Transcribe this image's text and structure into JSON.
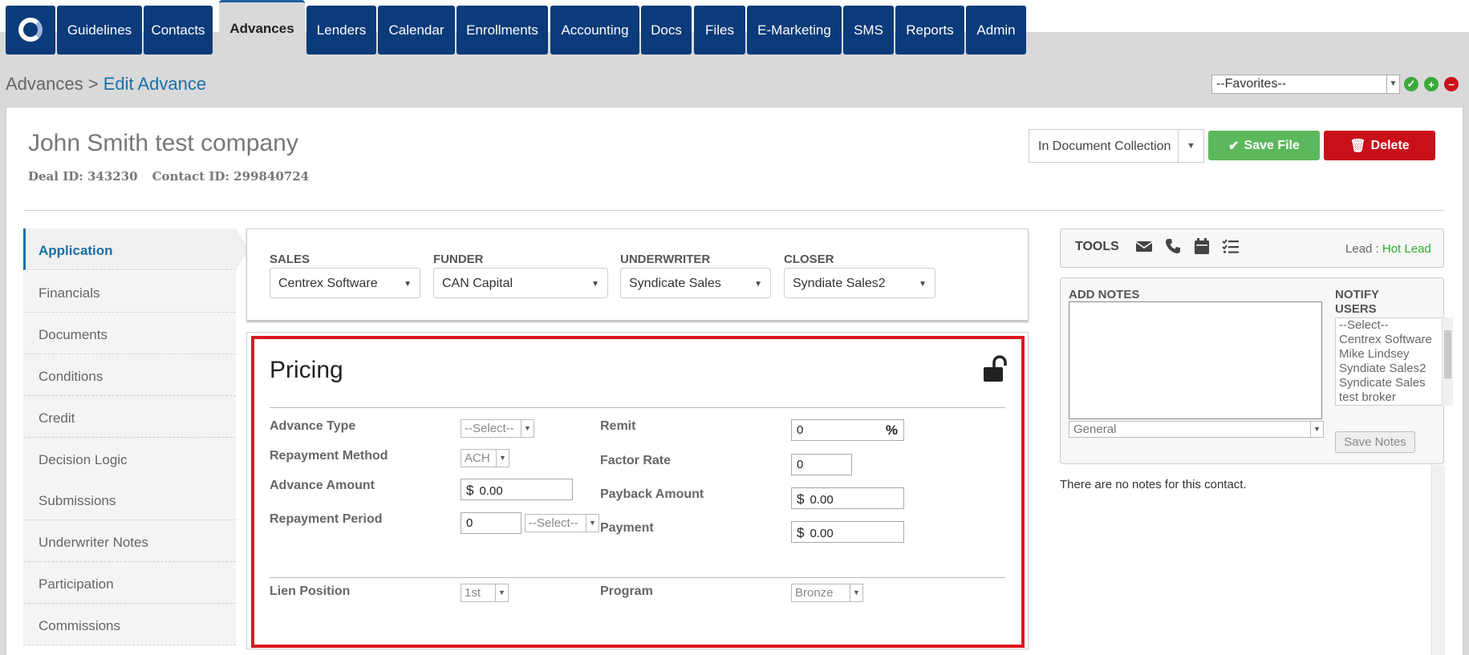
{
  "nav": {
    "tabs": [
      "Guidelines",
      "Contacts",
      "Advances",
      "Lenders",
      "Calendar",
      "Enrollments",
      "Accounting",
      "Docs",
      "Files",
      "E-Marketing",
      "SMS",
      "Reports",
      "Admin"
    ],
    "active": "Advances"
  },
  "breadcrumb": {
    "parent": "Advances",
    "separator": " > ",
    "current": "Edit Advance"
  },
  "favorites": {
    "value": "--Favorites--"
  },
  "record": {
    "company": "John Smith test company",
    "deal_id": "Deal ID: 343230",
    "contact_id": "Contact ID: 299840724",
    "status": "In Document Collection",
    "save_label": "Save File",
    "delete_label": "Delete"
  },
  "sidebar": {
    "items": [
      "Application",
      "Financials",
      "Documents",
      "Conditions",
      "Credit",
      "Decision Logic",
      "Submissions",
      "Underwriter Notes",
      "Participation",
      "Commissions"
    ],
    "active": "Application"
  },
  "team": {
    "sales": {
      "label": "SALES",
      "value": "Centrex Software"
    },
    "funder": {
      "label": "FUNDER",
      "value": "CAN Capital"
    },
    "underwriter": {
      "label": "UNDERWRITER",
      "value": "Syndicate Sales"
    },
    "closer": {
      "label": "CLOSER",
      "value": "Syndiate Sales2"
    }
  },
  "pricing": {
    "title": "Pricing",
    "advance_type": {
      "label": "Advance Type",
      "value": "--Select--"
    },
    "repayment_method": {
      "label": "Repayment Method",
      "value": "ACH"
    },
    "advance_amount": {
      "label": "Advance Amount",
      "currency": "$",
      "value": "0.00"
    },
    "repayment_period": {
      "label": "Repayment Period",
      "value": "0",
      "unit": "--Select--"
    },
    "remit": {
      "label": "Remit",
      "value": "0",
      "suffix": "%"
    },
    "factor_rate": {
      "label": "Factor Rate",
      "value": "0"
    },
    "payback_amount": {
      "label": "Payback Amount",
      "currency": "$",
      "value": "0.00"
    },
    "payment": {
      "label": "Payment",
      "currency": "$",
      "value": "0.00"
    },
    "lien_position": {
      "label": "Lien Position",
      "value": "1st"
    },
    "program": {
      "label": "Program",
      "value": "Bronze"
    }
  },
  "tools": {
    "label": "TOOLS",
    "lead_label": "Lead : ",
    "lead_value": "Hot Lead",
    "lead_color": "#2eaa2e"
  },
  "notes": {
    "add_label": "ADD NOTES",
    "notify_label_1": "NOTIFY",
    "notify_label_2": "USERS",
    "users": [
      "--Select--",
      "Centrex Software",
      "Mike Lindsey",
      "Syndiate Sales2",
      "Syndicate Sales",
      "test broker"
    ],
    "type": "General",
    "save_label": "Save Notes",
    "empty_text": "There are no notes for this contact."
  },
  "colors": {
    "nav": "#0b3b7a",
    "save": "#5cb85c",
    "delete": "#c9101a",
    "highlight": "#e0141e"
  }
}
